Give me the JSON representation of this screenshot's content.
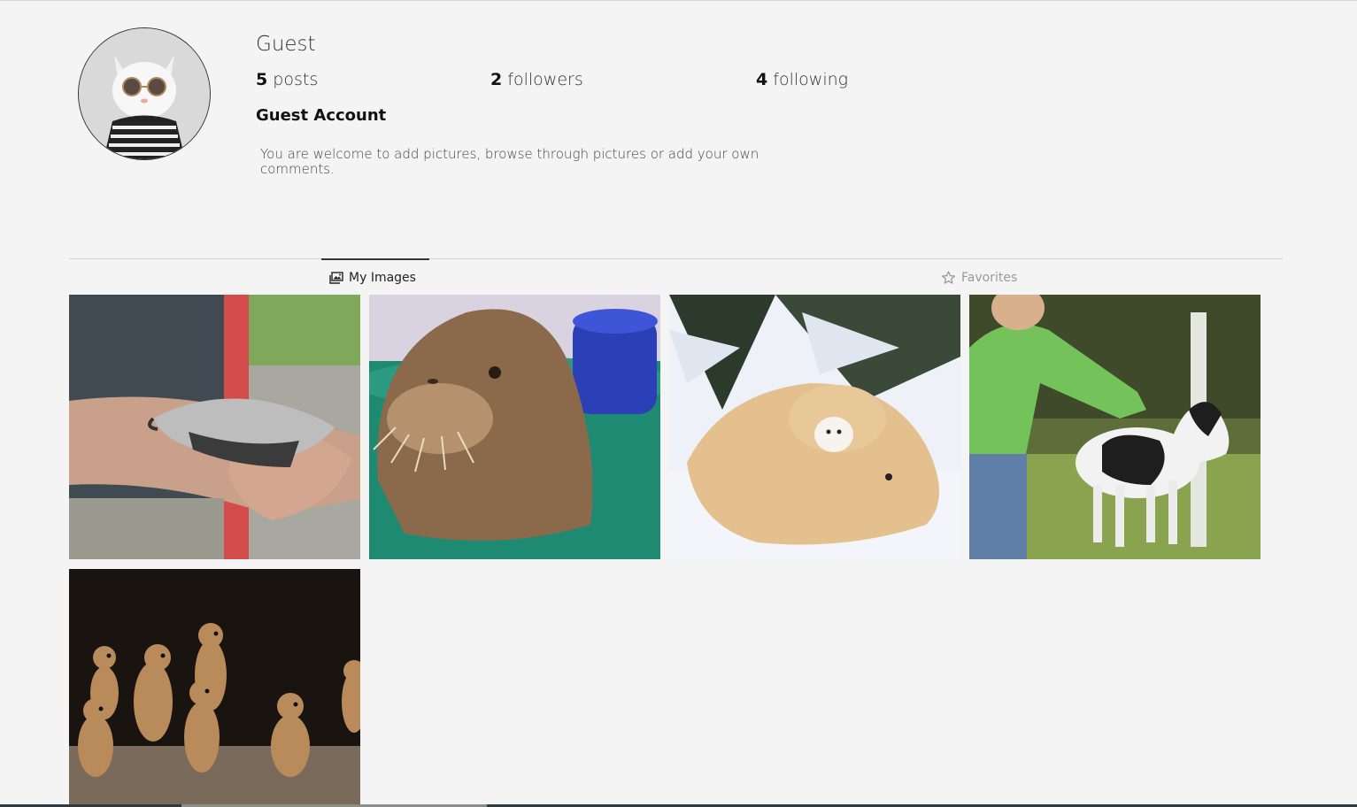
{
  "profile": {
    "username": "Guest",
    "posts_count": "5",
    "posts_label": "posts",
    "followers_count": "2",
    "followers_label": "followers",
    "following_count": "4",
    "following_label": "following",
    "full_name": "Guest Account",
    "bio": "You are welcome to add pictures, browse through pictures or add your own comments."
  },
  "tabs": {
    "my_images": "My Images",
    "favorites": "Favorites",
    "active": "my_images"
  },
  "gallery": {
    "images": [
      {
        "subject": "baby anteater on arm"
      },
      {
        "subject": "baby walrus in tub"
      },
      {
        "subject": "polar bear with cub"
      },
      {
        "subject": "miniature foal with ruler"
      },
      {
        "subject": "ground squirrels standing"
      }
    ]
  },
  "icons": {
    "my_images_tab": "images-icon",
    "favorites_tab": "star-outline-icon"
  },
  "colors": {
    "background": "#f4f4f4",
    "active_tab_text": "#222222",
    "inactive_tab_text": "#999999",
    "divider": "#cfcfcf"
  }
}
